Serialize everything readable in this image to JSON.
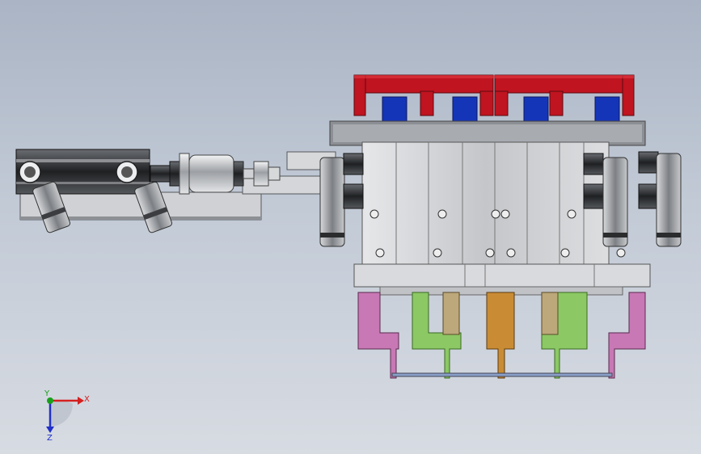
{
  "triad": {
    "x_label": "X",
    "y_label": "Y",
    "z_label": "Z",
    "colors": {
      "x": "#d42020",
      "y": "#19a019",
      "z": "#2030c8"
    }
  },
  "colors": {
    "background_top": "#aab4c4",
    "background_bottom": "#d7dbe2",
    "bridge_red": "#c01420",
    "block_blue": "#1535b8",
    "body_gray": "#c9cbcf",
    "dark_metal": "#3a3c40",
    "jaw_pink": "#c878b4",
    "jaw_green": "#8cc864",
    "jaw_tan": "#bca87a",
    "jaw_orange": "#c98c34"
  }
}
